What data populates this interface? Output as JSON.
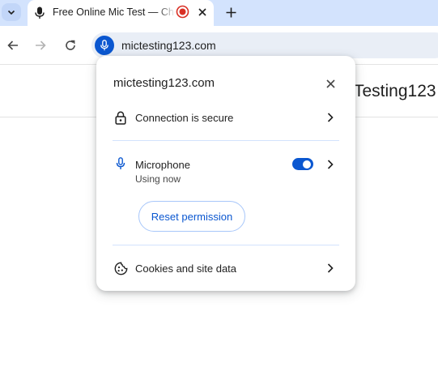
{
  "tab": {
    "title": "Free Online Mic Test — Check Microphone",
    "favicon": "microphone-icon",
    "indicator": "recording-indicator-icon"
  },
  "toolbar": {
    "url": "mictesting123.com",
    "site_info_icon": "microphone-icon"
  },
  "page": {
    "heading": "Testing123"
  },
  "popup": {
    "title": "mictesting123.com",
    "connection_label": "Connection is secure",
    "permissions": [
      {
        "label": "Microphone",
        "status": "Using now",
        "enabled": true,
        "icon": "microphone-icon"
      }
    ],
    "reset_label": "Reset permission",
    "cookies_label": "Cookies and site data"
  },
  "colors": {
    "accent": "#0b57d0",
    "tabstrip": "#d3e3fd",
    "omnibox": "#e9eef6",
    "record": "#d93025"
  }
}
